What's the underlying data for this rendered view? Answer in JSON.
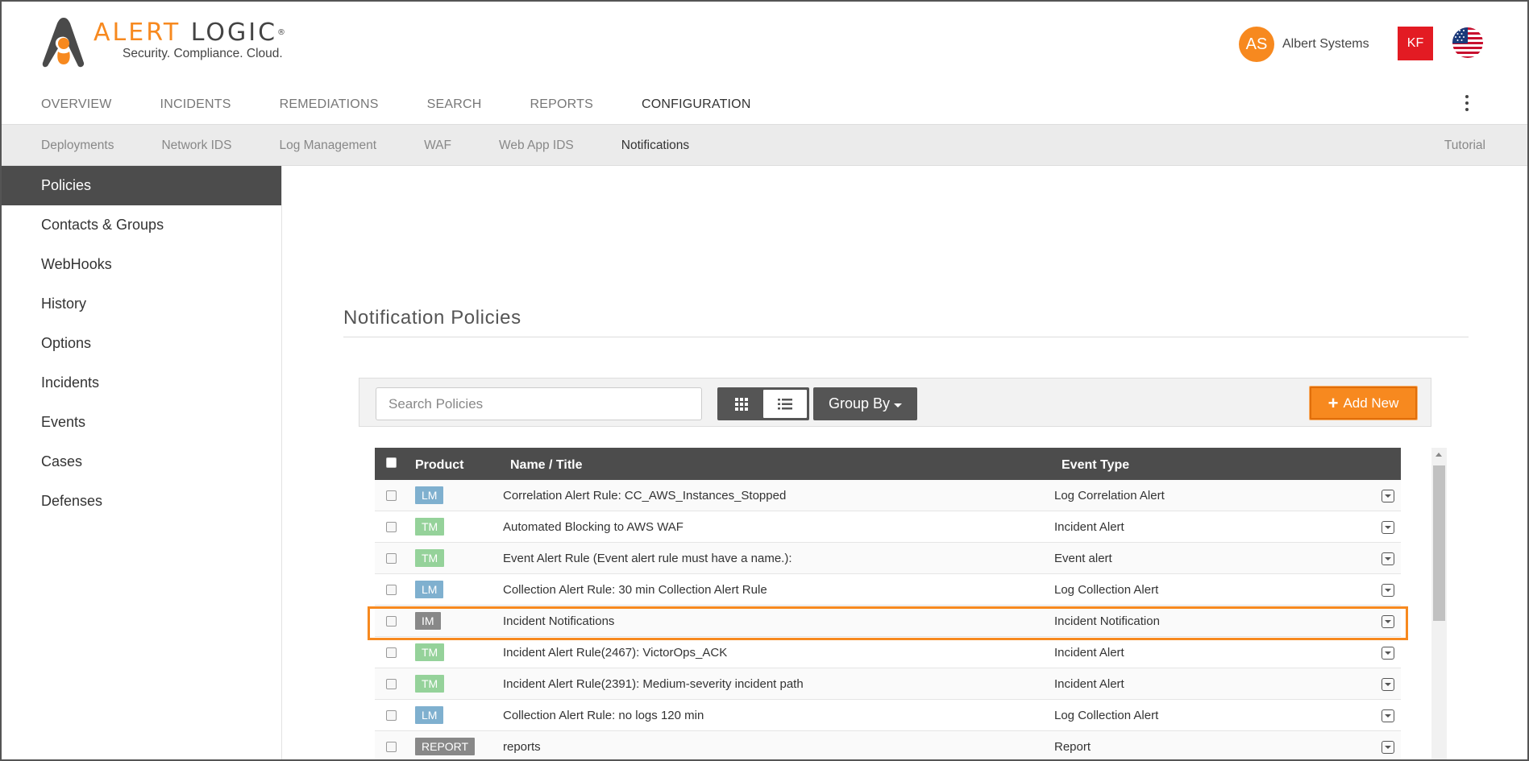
{
  "brand": {
    "name_orange": "ALERT",
    "name_dark": "LOGIC",
    "reg": "®",
    "tagline": "Security. Compliance. Cloud.",
    "accent": "#f7891f"
  },
  "account": {
    "initials": "AS",
    "name": "Albert Systems",
    "user_initials": "KF",
    "user_color": "#e31b23",
    "locale_icon": "us-flag-icon"
  },
  "topnav": [
    {
      "label": "OVERVIEW",
      "active": false
    },
    {
      "label": "INCIDENTS",
      "active": false
    },
    {
      "label": "REMEDIATIONS",
      "active": false
    },
    {
      "label": "SEARCH",
      "active": false
    },
    {
      "label": "REPORTS",
      "active": false
    },
    {
      "label": "CONFIGURATION",
      "active": true
    }
  ],
  "subnav": {
    "items": [
      {
        "label": "Deployments",
        "active": false
      },
      {
        "label": "Network IDS",
        "active": false
      },
      {
        "label": "Log Management",
        "active": false
      },
      {
        "label": "WAF",
        "active": false
      },
      {
        "label": "Web App IDS",
        "active": false
      },
      {
        "label": "Notifications",
        "active": true
      }
    ],
    "tutorial": "Tutorial"
  },
  "sidebar": [
    {
      "label": "Policies",
      "active": true
    },
    {
      "label": "Contacts & Groups",
      "active": false
    },
    {
      "label": "WebHooks",
      "active": false
    },
    {
      "label": "History",
      "active": false
    },
    {
      "label": "Options",
      "active": false
    },
    {
      "label": "Incidents",
      "active": false
    },
    {
      "label": "Events",
      "active": false
    },
    {
      "label": "Cases",
      "active": false
    },
    {
      "label": "Defenses",
      "active": false
    }
  ],
  "main": {
    "title": "Notification Policies",
    "search_placeholder": "Search Policies",
    "group_by": "Group By",
    "add_new": "Add New"
  },
  "table": {
    "columns": {
      "product": "Product",
      "name": "Name / Title",
      "event_type": "Event Type"
    },
    "badge_colors": {
      "LM": "#7fb0cf",
      "TM": "#95d29a",
      "IM": "#888888",
      "REPORT": "#888888"
    },
    "rows": [
      {
        "product": "LM",
        "name": "Correlation Alert Rule: CC_AWS_Instances_Stopped",
        "event_type": "Log Correlation Alert"
      },
      {
        "product": "TM",
        "name": "Automated Blocking to AWS WAF",
        "event_type": "Incident Alert"
      },
      {
        "product": "TM",
        "name": "Event Alert Rule (Event alert rule must have a name.):",
        "event_type": "Event alert"
      },
      {
        "product": "LM",
        "name": "Collection Alert Rule: 30 min Collection Alert Rule",
        "event_type": "Log Collection Alert"
      },
      {
        "product": "IM",
        "name": "Incident Notifications",
        "event_type": "Incident Notification"
      },
      {
        "product": "TM",
        "name": "Incident Alert Rule(2467): VictorOps_ACK",
        "event_type": "Incident Alert"
      },
      {
        "product": "TM",
        "name": "Incident Alert Rule(2391): Medium-severity incident path",
        "event_type": "Incident Alert"
      },
      {
        "product": "LM",
        "name": "Collection Alert Rule: no logs 120 min",
        "event_type": "Log Collection Alert"
      },
      {
        "product": "REPORT",
        "name": "reports",
        "event_type": "Report"
      }
    ]
  }
}
